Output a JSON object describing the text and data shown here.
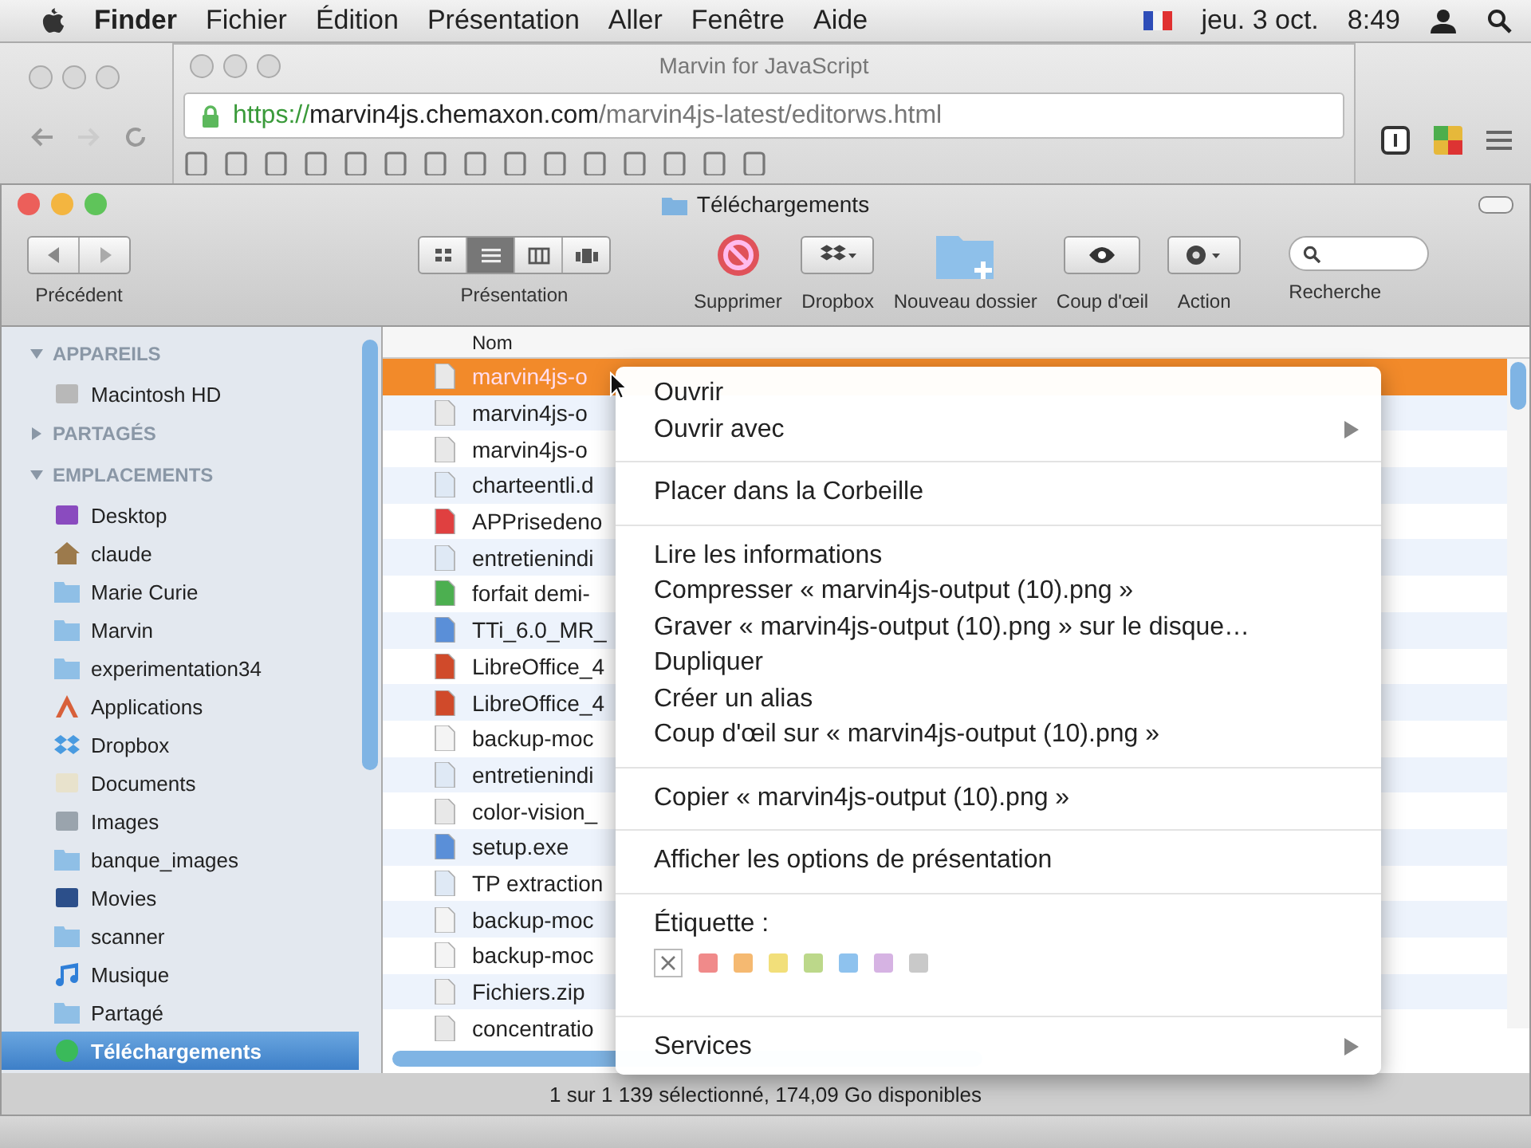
{
  "menubar": {
    "app": "Finder",
    "menus": [
      "Fichier",
      "Édition",
      "Présentation",
      "Aller",
      "Fenêtre",
      "Aide"
    ],
    "date": "jeu. 3 oct.",
    "time": "8:49"
  },
  "browser": {
    "title": "Marvin for JavaScript",
    "url": {
      "scheme": "https://",
      "host": "marvin4js.chemaxon.com",
      "path": "/marvin4js-latest/editorws.html"
    }
  },
  "finder": {
    "title": "Téléchargements",
    "toolbar": {
      "back_label": "Précédent",
      "view_label": "Présentation",
      "views": [
        {
          "kind": "icons",
          "selected": false
        },
        {
          "kind": "list",
          "selected": true
        },
        {
          "kind": "columns",
          "selected": false
        },
        {
          "kind": "coverflow",
          "selected": false
        }
      ],
      "actions": [
        {
          "kind": "delete",
          "label": "Supprimer"
        },
        {
          "kind": "dropbox",
          "label": "Dropbox"
        },
        {
          "kind": "newfolder",
          "label": "Nouveau dossier"
        },
        {
          "kind": "quicklook",
          "label": "Coup d'œil"
        },
        {
          "kind": "action",
          "label": "Action"
        }
      ],
      "search_label": "Recherche"
    },
    "sidebar": [
      {
        "title": "APPAREILS",
        "expanded": true,
        "items": [
          {
            "kind": "disk",
            "label": "Macintosh HD",
            "selected": false
          }
        ]
      },
      {
        "title": "PARTAGÉS",
        "expanded": false
      },
      {
        "title": "EMPLACEMENTS",
        "expanded": true,
        "items": [
          {
            "kind": "desktop",
            "label": "Desktop",
            "selected": false
          },
          {
            "kind": "home",
            "label": "claude",
            "selected": false
          },
          {
            "kind": "folder",
            "label": "Marie Curie",
            "selected": false
          },
          {
            "kind": "folder",
            "label": "Marvin",
            "selected": false
          },
          {
            "kind": "folder",
            "label": "experimentation34",
            "selected": false
          },
          {
            "kind": "apps",
            "label": "Applications",
            "selected": false
          },
          {
            "kind": "dropbox",
            "label": "Dropbox",
            "selected": false
          },
          {
            "kind": "docs",
            "label": "Documents",
            "selected": false
          },
          {
            "kind": "images",
            "label": "Images",
            "selected": false
          },
          {
            "kind": "folder",
            "label": "banque_images",
            "selected": false
          },
          {
            "kind": "movies",
            "label": "Movies",
            "selected": false
          },
          {
            "kind": "folder",
            "label": "scanner",
            "selected": false
          },
          {
            "kind": "music",
            "label": "Musique",
            "selected": false
          },
          {
            "kind": "folder",
            "label": "Partagé",
            "selected": false
          },
          {
            "kind": "download",
            "label": "Téléchargements",
            "selected": true
          }
        ]
      }
    ],
    "column": "Nom",
    "files": [
      {
        "kind": "image",
        "name": "marvin4js-o",
        "selected": true
      },
      {
        "kind": "image",
        "name": "marvin4js-o",
        "selected": false
      },
      {
        "kind": "image",
        "name": "marvin4js-o",
        "selected": false
      },
      {
        "kind": "doc",
        "name": "charteentli.d",
        "selected": false
      },
      {
        "kind": "pdf",
        "name": "APPrisedeno",
        "selected": false
      },
      {
        "kind": "doc",
        "name": "entretienindi",
        "selected": false
      },
      {
        "kind": "sheet",
        "name": "forfait demi-",
        "selected": false
      },
      {
        "kind": "exe",
        "name": "TTi_6.0_MR_",
        "selected": false
      },
      {
        "kind": "app",
        "name": "LibreOffice_4",
        "selected": false
      },
      {
        "kind": "app",
        "name": "LibreOffice_4",
        "selected": false
      },
      {
        "kind": "blank",
        "name": "backup-moc",
        "selected": false
      },
      {
        "kind": "doc",
        "name": "entretienindi",
        "selected": false
      },
      {
        "kind": "image",
        "name": "color-vision_",
        "selected": false
      },
      {
        "kind": "exe",
        "name": "setup.exe",
        "selected": false
      },
      {
        "kind": "doc",
        "name": "TP extraction",
        "selected": false
      },
      {
        "kind": "blank",
        "name": "backup-moc",
        "selected": false
      },
      {
        "kind": "blank",
        "name": "backup-moc",
        "selected": false
      },
      {
        "kind": "zip",
        "name": "Fichiers.zip",
        "selected": false
      },
      {
        "kind": "image",
        "name": "concentratio",
        "selected": false
      }
    ],
    "status": "1 sur 1 139 sélectionné, 174,09 Go disponibles"
  },
  "context_menu": {
    "groups": [
      {
        "items": [
          {
            "label": "Ouvrir",
            "submenu": false
          },
          {
            "label": "Ouvrir avec",
            "submenu": true
          }
        ]
      },
      {
        "items": [
          {
            "label": "Placer dans la Corbeille",
            "submenu": false
          }
        ]
      },
      {
        "items": [
          {
            "label": "Lire les informations",
            "submenu": false
          },
          {
            "label": "Compresser « marvin4js-output (10).png »",
            "submenu": false
          },
          {
            "label": "Graver « marvin4js-output (10).png » sur le disque…",
            "submenu": false
          },
          {
            "label": "Dupliquer",
            "submenu": false
          },
          {
            "label": "Créer un alias",
            "submenu": false
          },
          {
            "label": "Coup d'œil sur « marvin4js-output (10).png »",
            "submenu": false
          }
        ]
      },
      {
        "items": [
          {
            "label": "Copier « marvin4js-output (10).png »",
            "submenu": false
          }
        ]
      },
      {
        "items": [
          {
            "label": "Afficher les options de présentation",
            "submenu": false
          }
        ]
      }
    ],
    "label_section": {
      "title": "Étiquette :",
      "colors": [
        {
          "color": "#f08a8a"
        },
        {
          "color": "#f5b971"
        },
        {
          "color": "#f2df7a"
        },
        {
          "color": "#bcd88a"
        },
        {
          "color": "#8ec2ee"
        },
        {
          "color": "#d6b3e3"
        },
        {
          "color": "#c9c9c9"
        }
      ]
    },
    "services": {
      "label": "Services",
      "submenu": true
    }
  }
}
